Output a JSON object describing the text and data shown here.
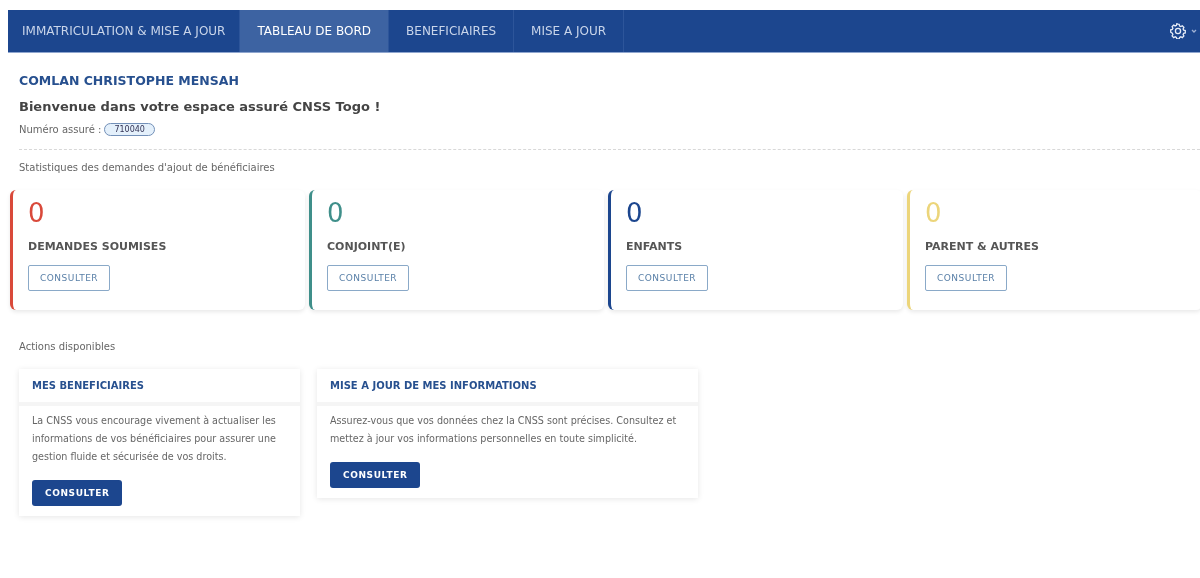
{
  "nav": {
    "tabs": [
      {
        "label": "IMMATRICULATION & MISE A JOUR",
        "selected": false
      },
      {
        "label": "TABLEAU DE BORD",
        "selected": true
      },
      {
        "label": "BENEFICIAIRES",
        "selected": false
      },
      {
        "label": "MISE A JOUR",
        "selected": false
      }
    ]
  },
  "user": {
    "name": "COMLAN CHRISTOPHE MENSAH",
    "welcome": "Bienvenue dans votre espace assuré CNSS Togo !",
    "number_label": "Numéro assuré :",
    "number": "710040"
  },
  "stats": {
    "title": "Statistiques des demandes d'ajout de bénéficiaires",
    "cards": [
      {
        "count": "0",
        "label": "DEMANDES SOUMISES",
        "button": "CONSULTER",
        "color": "#d9493a"
      },
      {
        "count": "0",
        "label": "CONJOINT(E)",
        "button": "CONSULTER",
        "color": "#3f8f8a"
      },
      {
        "count": "0",
        "label": "ENFANTS",
        "button": "CONSULTER",
        "color": "#1c468e"
      },
      {
        "count": "0",
        "label": "PARENT & AUTRES",
        "button": "CONSULTER",
        "color": "#ecd57a"
      }
    ]
  },
  "actions": {
    "title": "Actions disponibles",
    "cards": [
      {
        "title": "MES BENEFICIAIRES",
        "text": "La CNSS vous encourage vivement à actualiser les informations de vos bénéficiaires pour assurer une gestion fluide et sécurisée de vos droits.",
        "button": "CONSULTER"
      },
      {
        "title": "MISE A JOUR DE MES INFORMATIONS",
        "text": "Assurez-vous que vos données chez la CNSS sont précises. Consultez et mettez à jour vos informations personnelles en toute simplicité.",
        "button": "CONSULTER"
      }
    ]
  }
}
